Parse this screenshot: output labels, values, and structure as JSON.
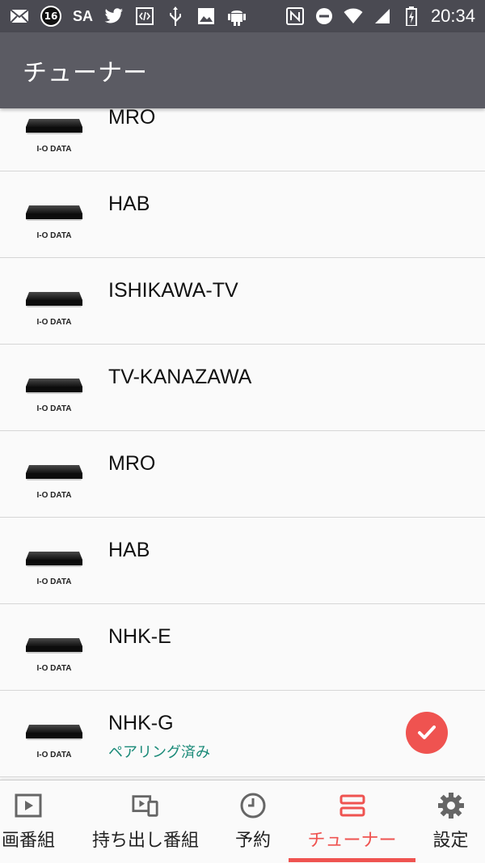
{
  "status_bar": {
    "left_icons": [
      "mail-x-icon",
      "badge-16-icon",
      "sa-text",
      "twitter-icon",
      "code-icon",
      "usb-icon",
      "image-icon",
      "android-icon"
    ],
    "badge_number": "16",
    "sa_text": "SA",
    "right_icons": [
      "nfc-icon",
      "dnd-icon",
      "wifi-icon",
      "signal-icon",
      "battery-icon"
    ],
    "time": "20:34"
  },
  "app_bar": {
    "title": "チューナー"
  },
  "device_logo_text": "I-O DATA",
  "tuners": [
    {
      "name": "MRO",
      "status": ""
    },
    {
      "name": "HAB",
      "status": ""
    },
    {
      "name": "ISHIKAWA-TV",
      "status": ""
    },
    {
      "name": "TV-KANAZAWA",
      "status": ""
    },
    {
      "name": "MRO",
      "status": ""
    },
    {
      "name": "HAB",
      "status": ""
    },
    {
      "name": "NHK-E",
      "status": ""
    },
    {
      "name": "NHK-G",
      "status": "ペアリング済み",
      "selected": true
    }
  ],
  "bottom_nav": [
    {
      "label": "画番組",
      "icon": "play-icon"
    },
    {
      "label": "持ち出し番組",
      "icon": "takeout-icon"
    },
    {
      "label": "予約",
      "icon": "clock-icon"
    },
    {
      "label": "チューナー",
      "icon": "tuner-icon",
      "active": true
    },
    {
      "label": "設定",
      "icon": "gear-icon"
    }
  ],
  "colors": {
    "accent": "#ef5350",
    "app_bar": "#5b5b63",
    "status_bar": "#4a4a52",
    "paired_text": "#1a8a78"
  }
}
